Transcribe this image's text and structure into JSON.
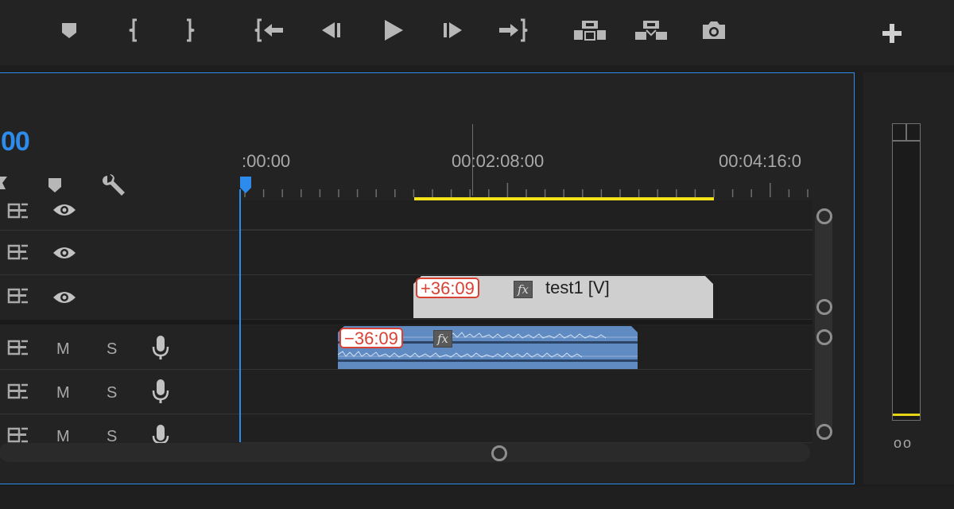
{
  "toolbar": {
    "buttons": [
      {
        "name": "add-marker-button",
        "icon": "marker-icon"
      },
      {
        "name": "mark-in-button",
        "icon": "mark-in-icon"
      },
      {
        "name": "mark-out-button",
        "icon": "mark-out-icon"
      },
      {
        "name": "go-to-in-button",
        "icon": "go-to-in-icon"
      },
      {
        "name": "step-back-button",
        "icon": "step-back-icon"
      },
      {
        "name": "play-button",
        "icon": "play-icon"
      },
      {
        "name": "step-forward-button",
        "icon": "step-forward-icon"
      },
      {
        "name": "go-to-out-button",
        "icon": "go-to-out-icon"
      },
      {
        "name": "lift-button",
        "icon": "lift-icon"
      },
      {
        "name": "extract-button",
        "icon": "extract-icon"
      },
      {
        "name": "export-frame-button",
        "icon": "camera-icon"
      },
      {
        "name": "button-editor-button",
        "icon": "plus-icon"
      }
    ]
  },
  "timeline": {
    "timecode_fragment": "00",
    "ruler": {
      "labels": [
        ":00:00",
        "00:02:08:00",
        "00:04:16:0"
      ]
    },
    "video_tracks": [
      {
        "toggle_icon": "toggle-track-output-icon",
        "visibility_icon": "eye-icon"
      },
      {
        "toggle_icon": "toggle-track-output-icon",
        "visibility_icon": "eye-icon"
      },
      {
        "toggle_icon": "toggle-track-output-icon",
        "visibility_icon": "eye-icon"
      }
    ],
    "audio_tracks": [
      {
        "mute_label": "M",
        "solo_label": "S",
        "mic_icon": "mic-icon"
      },
      {
        "mute_label": "M",
        "solo_label": "S",
        "mic_icon": "mic-icon"
      },
      {
        "mute_label": "M",
        "solo_label": "S",
        "mic_icon": "mic-icon"
      }
    ],
    "video_clip": {
      "name": "test1 [V]",
      "offset": "+36:09",
      "fx_label": "fx"
    },
    "audio_clip": {
      "offset": "−36:09",
      "fx_label": "fx"
    }
  },
  "meters": {
    "toggle_label": "oo"
  },
  "colors": {
    "accent": "#2d8ceb",
    "work_area": "#f2e31a",
    "offset_red": "#d84234",
    "video_clip": "#cfcfcf",
    "audio_clip": "#5f8ac2"
  }
}
